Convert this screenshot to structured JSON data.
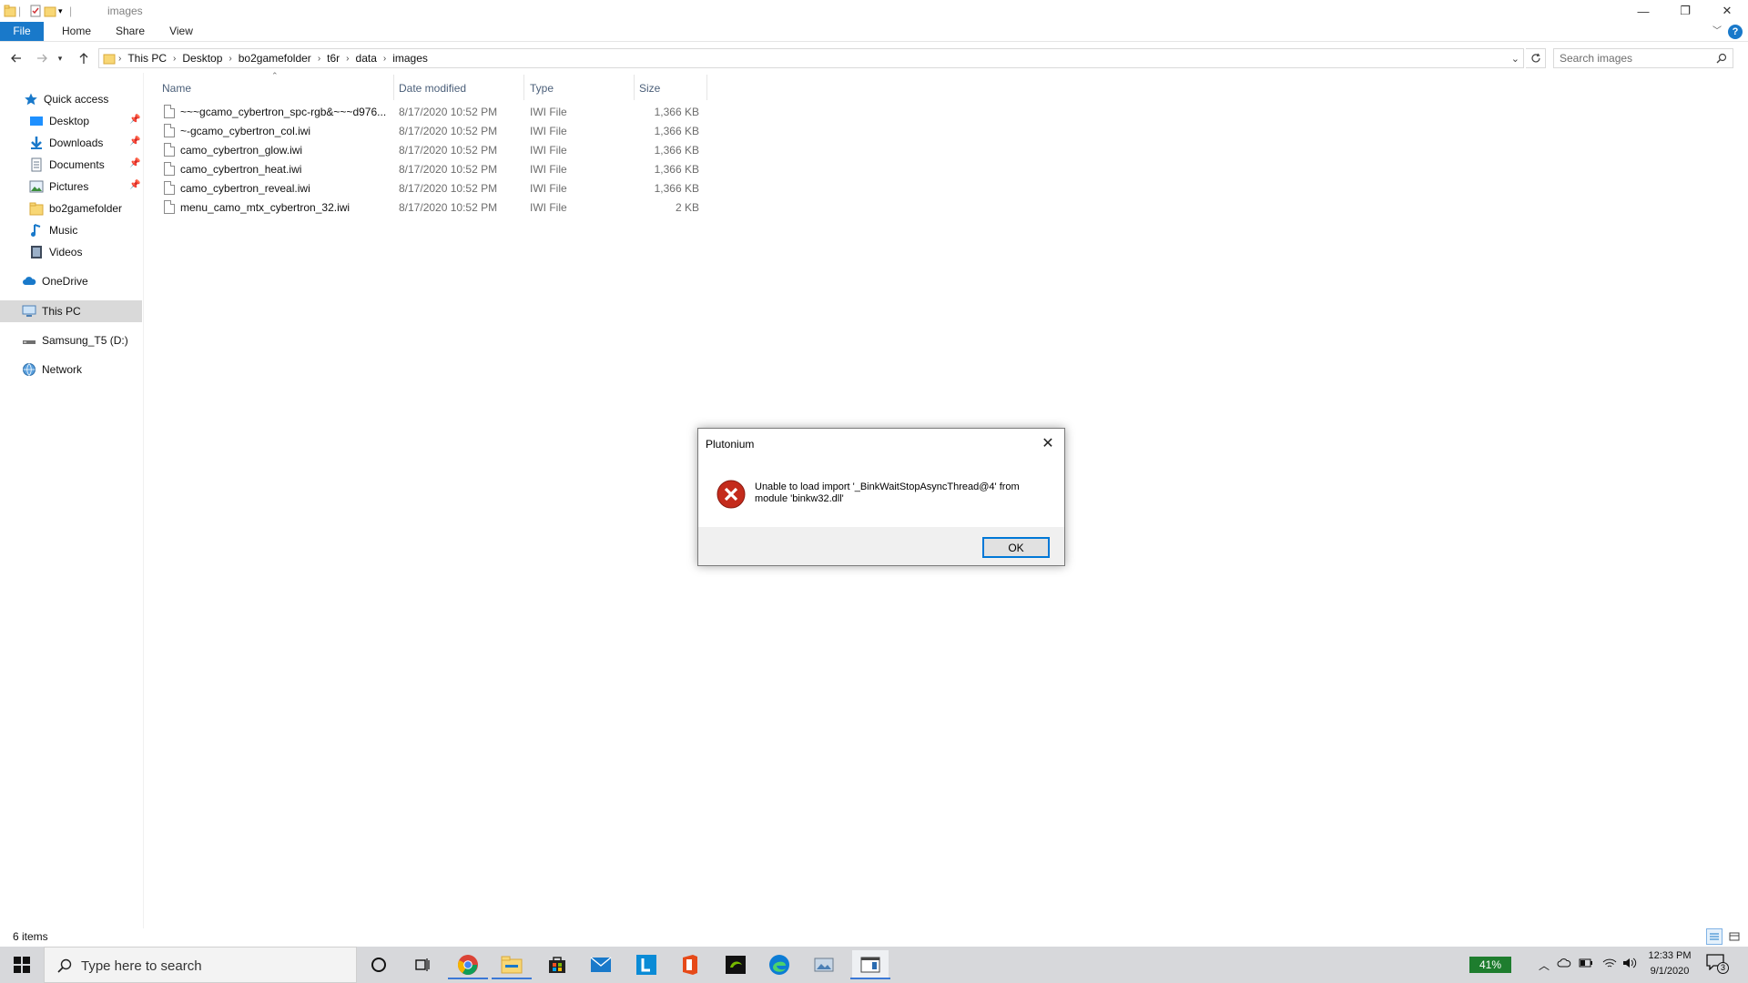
{
  "window": {
    "title": "images",
    "minimize": "—",
    "restore": "❐",
    "close": "✕",
    "help": "?"
  },
  "ribbon": {
    "tabs": [
      "File",
      "Home",
      "Share",
      "View"
    ]
  },
  "address": {
    "crumbs": [
      "This PC",
      "Desktop",
      "bo2gamefolder",
      "t6r",
      "data",
      "images"
    ]
  },
  "search": {
    "placeholder": "Search images"
  },
  "navpane": {
    "quick_access": "Quick access",
    "items": [
      "Desktop",
      "Downloads",
      "Documents",
      "Pictures",
      "bo2gamefolder",
      "Music",
      "Videos"
    ],
    "onedrive": "OneDrive",
    "thispc": "This PC",
    "drive": "Samsung_T5 (D:)",
    "network": "Network"
  },
  "filelist": {
    "headers": {
      "name": "Name",
      "date": "Date modified",
      "type": "Type",
      "size": "Size"
    },
    "rows": [
      {
        "name": "~~~gcamo_cybertron_spc-rgb&~~~d976...",
        "date": "8/17/2020 10:52 PM",
        "type": "IWI File",
        "size": "1,366 KB"
      },
      {
        "name": "~-gcamo_cybertron_col.iwi",
        "date": "8/17/2020 10:52 PM",
        "type": "IWI File",
        "size": "1,366 KB"
      },
      {
        "name": "camo_cybertron_glow.iwi",
        "date": "8/17/2020 10:52 PM",
        "type": "IWI File",
        "size": "1,366 KB"
      },
      {
        "name": "camo_cybertron_heat.iwi",
        "date": "8/17/2020 10:52 PM",
        "type": "IWI File",
        "size": "1,366 KB"
      },
      {
        "name": "camo_cybertron_reveal.iwi",
        "date": "8/17/2020 10:52 PM",
        "type": "IWI File",
        "size": "1,366 KB"
      },
      {
        "name": "menu_camo_mtx_cybertron_32.iwi",
        "date": "8/17/2020 10:52 PM",
        "type": "IWI File",
        "size": "2 KB"
      }
    ]
  },
  "status": {
    "item_count": "6 items"
  },
  "dialog": {
    "title": "Plutonium",
    "message": "Unable to load import '_BinkWaitStopAsyncThread@4' from module 'binkw32.dll'",
    "ok": "OK"
  },
  "taskbar": {
    "search_placeholder": "Type here to search",
    "battery": "41%",
    "time": "12:33 PM",
    "date": "9/1/2020",
    "notifications": "3"
  }
}
